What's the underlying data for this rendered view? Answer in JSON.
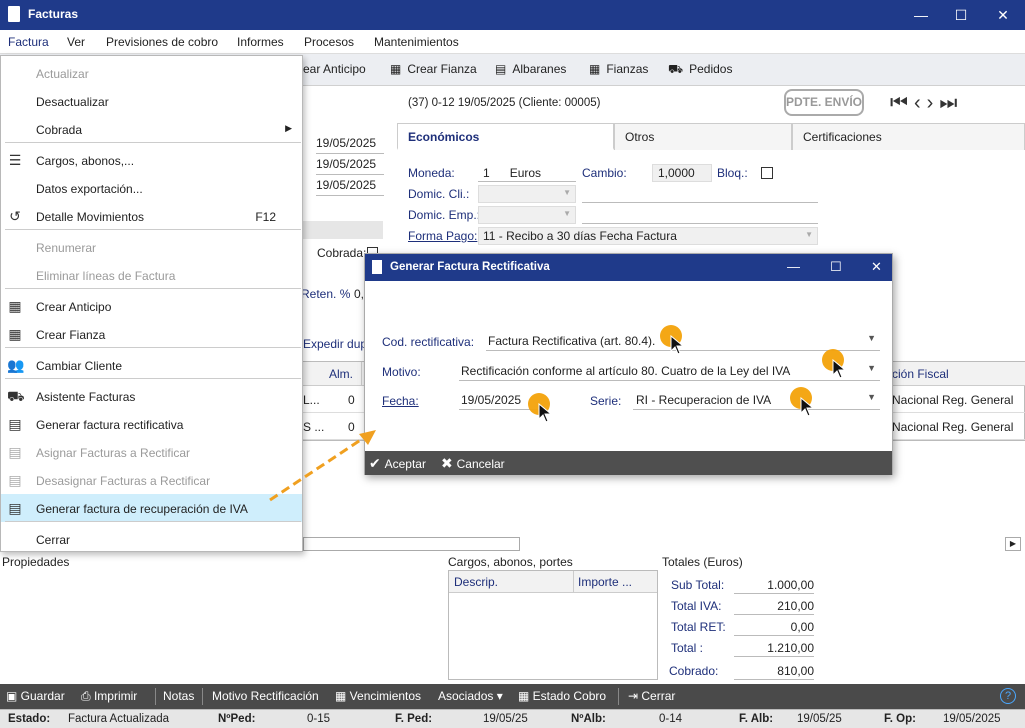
{
  "window": {
    "title": "Facturas"
  },
  "menubar": [
    "Factura",
    "Ver",
    "Previsiones de cobro",
    "Informes",
    "Procesos",
    "Mantenimientos"
  ],
  "toolbar": {
    "crear_anticipo": "ear Anticipo",
    "crear_fianza": "Crear Fianza",
    "albaranes": "Albaranes",
    "fianzas": "Fianzas",
    "pedidos": "Pedidos"
  },
  "header": {
    "doc_info": "(37) 0-12  19/05/2025  (Cliente: 00005)",
    "stamp": "PDTE. ENVÍO"
  },
  "dates": [
    "19/05/2025",
    "19/05/2025",
    "19/05/2025"
  ],
  "left_labels": {
    "cobrada": "Cobrada:",
    "reten": "Reten. %",
    "reten_val": "0,",
    "expedir": "Expedir dupl"
  },
  "tabs": [
    "Económicos",
    "Otros",
    "Certificaciones"
  ],
  "economicos": {
    "moneda_label": "Moneda:",
    "moneda_code": "1",
    "moneda_name": "Euros",
    "cambio_label": "Cambio:",
    "cambio_value": "1,0000",
    "bloq_label": "Bloq.:",
    "domic_cli_label": "Domic. Cli.:",
    "domic_emp_label": "Domic. Emp.:",
    "forma_pago_label": "Forma Pago:",
    "forma_pago_value": "11 - Recibo a 30 días Fecha Factura"
  },
  "context_menu": {
    "items": [
      {
        "label": "Actualizar",
        "disabled": true,
        "icon": ""
      },
      {
        "label": "Desactualizar",
        "disabled": false,
        "icon": ""
      },
      {
        "label": "Cobrada",
        "disabled": false,
        "icon": "",
        "submenu": true
      },
      {
        "label": "Cargos, abonos,...",
        "disabled": false,
        "icon": "list-icon"
      },
      {
        "label": "Datos exportación...",
        "disabled": false,
        "icon": ""
      },
      {
        "label": "Detalle Movimientos",
        "disabled": false,
        "icon": "history-icon",
        "shortcut": "F12"
      },
      {
        "label": "Renumerar",
        "disabled": true,
        "icon": ""
      },
      {
        "label": "Eliminar líneas de Factura",
        "disabled": true,
        "icon": ""
      },
      {
        "label": "Crear Anticipo",
        "disabled": false,
        "icon": "calculator-icon"
      },
      {
        "label": "Crear Fianza",
        "disabled": false,
        "icon": "calculator-icon"
      },
      {
        "label": "Cambiar Cliente",
        "disabled": false,
        "icon": "people-icon"
      },
      {
        "label": "Asistente Facturas",
        "disabled": false,
        "icon": "basket-icon"
      },
      {
        "label": "Generar factura rectificativa",
        "disabled": false,
        "icon": "document-icon"
      },
      {
        "label": "Asignar Facturas a Rectificar",
        "disabled": true,
        "icon": "document-icon"
      },
      {
        "label": "Desasignar Facturas a Rectificar",
        "disabled": true,
        "icon": "document-icon"
      },
      {
        "label": "Generar factura de recuperación de IVA",
        "disabled": false,
        "icon": "document-icon",
        "highlighted": true
      },
      {
        "label": "Cerrar",
        "disabled": false,
        "icon": ""
      }
    ]
  },
  "dialog": {
    "title": "Generar Factura Rectificativa",
    "cod_label": "Cod. rectificativa:",
    "cod_value": "Factura Rectificativa (art. 80.4).",
    "motivo_label": "Motivo:",
    "motivo_value": "Rectificación conforme al artículo 80. Cuatro de la Ley del IVA",
    "fecha_label": "Fecha:",
    "fecha_value": "19/05/2025",
    "serie_label": "Serie:",
    "serie_value": "RI - Recuperacion de IVA",
    "accept": "Aceptar",
    "cancel": "Cancelar"
  },
  "lines_grid": {
    "col_alm": "Alm.",
    "col_fiscal": "ción Fiscal",
    "rows": [
      {
        "prefix": "L...",
        "alm": "0",
        "fiscal": "Nacional Reg. General"
      },
      {
        "prefix": "S ...",
        "alm": "0",
        "fiscal": "Nacional Reg. General"
      }
    ]
  },
  "lower": {
    "propiedades": "Propiedades",
    "cargos_title": "Cargos, abonos, portes",
    "cargos_cols": [
      "Descrip.",
      "Importe ..."
    ],
    "totales_title": "Totales (Euros)",
    "totales": [
      {
        "label": "Sub Total:",
        "value": "1.000,00"
      },
      {
        "label": "Total IVA:",
        "value": "210,00"
      },
      {
        "label": "Total RET:",
        "value": "0,00"
      },
      {
        "label": "Total :",
        "value": "1.210,00"
      },
      {
        "label": "Cobrado:",
        "value": "810,00"
      }
    ]
  },
  "bottombar": {
    "guardar": "Guardar",
    "imprimir": "Imprimir",
    "notas": "Notas",
    "motivo": "Motivo Rectificación",
    "vencimientos": "Vencimientos",
    "asociados": "Asociados",
    "estado_cobro": "Estado Cobro",
    "cerrar": "Cerrar"
  },
  "status": {
    "estado_label": "Estado:",
    "estado_value": "Factura Actualizada",
    "nped_label": "NºPed:",
    "nped_value": "0-15",
    "fped_label": "F. Ped:",
    "fped_value": "19/05/25",
    "nalb_label": "NºAlb:",
    "nalb_value": "0-14",
    "falb_label": "F. Alb:",
    "falb_value": "19/05/25",
    "fop_label": "F. Op:",
    "fop_value": "19/05/2025"
  },
  "colors": {
    "title_bar": "#1f3a8a",
    "highlight": "#cfeefc",
    "cursor_dot": "#f3a20a",
    "arrow": "#f0a020"
  }
}
